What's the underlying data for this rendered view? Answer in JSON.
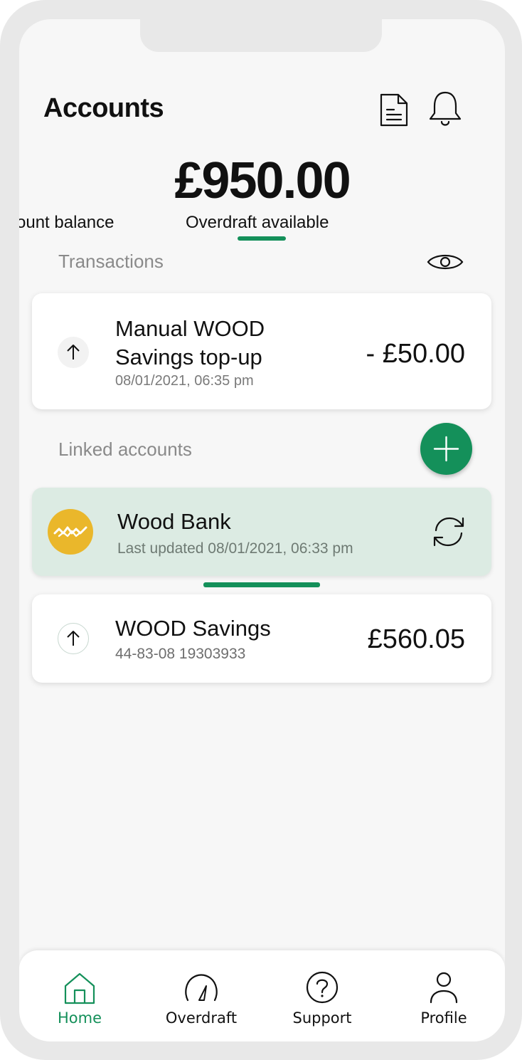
{
  "header": {
    "title": "Accounts",
    "icons": [
      "document-icon",
      "bell-icon"
    ]
  },
  "balance": {
    "amount": "£950.00",
    "tabs": [
      {
        "label": "ount balance",
        "active": false
      },
      {
        "label": "Overdraft available",
        "active": true
      }
    ]
  },
  "transactions": {
    "section_label": "Transactions",
    "visibility_icon": "eye-icon",
    "items": [
      {
        "title": "Manual WOOD Savings top-up",
        "date": "08/01/2021, 06:35 pm",
        "amount": "- £50.00",
        "icon": "arrow-up-icon"
      }
    ]
  },
  "linked_accounts": {
    "section_label": "Linked accounts",
    "add_icon": "plus-icon",
    "bank": {
      "name": "Wood Bank",
      "last_updated": "Last updated 08/01/2021, 06:33 pm",
      "logo": "wood-bank-logo",
      "refresh_icon": "refresh-icon"
    },
    "accounts": [
      {
        "name": "WOOD Savings",
        "number": "44-83-08 19303933",
        "amount": "£560.05",
        "icon": "arrow-up-icon"
      }
    ]
  },
  "bottom_nav": {
    "items": [
      {
        "label": "Home",
        "icon": "home-icon",
        "active": true
      },
      {
        "label": "Overdraft",
        "icon": "gauge-icon",
        "active": false
      },
      {
        "label": "Support",
        "icon": "help-icon",
        "active": false
      },
      {
        "label": "Profile",
        "icon": "person-icon",
        "active": false
      }
    ]
  },
  "colors": {
    "accent": "#14905a",
    "bank_card_bg": "#dcebe3",
    "bank_logo": "#eab72b",
    "screen_bg": "#f7f7f7",
    "frame": "#e8e8e8"
  }
}
